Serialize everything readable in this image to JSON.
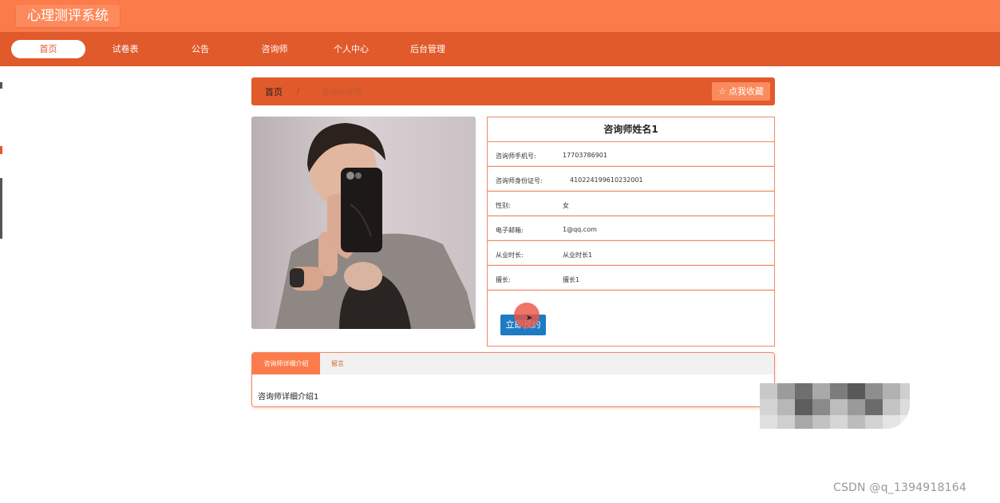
{
  "app": {
    "title": "心理测评系统"
  },
  "nav": {
    "items": [
      {
        "label": "首页"
      },
      {
        "label": "试卷表"
      },
      {
        "label": "公告"
      },
      {
        "label": "咨询师"
      },
      {
        "label": "个人中心"
      },
      {
        "label": "后台管理"
      }
    ],
    "active_index": 0
  },
  "breadcrumb": {
    "home": "首页",
    "separator": "/",
    "current": "咨询师详情",
    "favorite_label": "点我收藏"
  },
  "counselor": {
    "name": "咨询师姓名1",
    "fields": [
      {
        "label": "咨询师手机号:",
        "value": "17703786901"
      },
      {
        "label": "咨询师身份证号:",
        "value": "410224199610232001"
      },
      {
        "label": "性别:",
        "value": "女"
      },
      {
        "label": "电子邮箱:",
        "value": "1@qq.com"
      },
      {
        "label": "从业时长:",
        "value": "从业时长1"
      },
      {
        "label": "擅长:",
        "value": "擅长1"
      }
    ],
    "book_label": "立即预约"
  },
  "tabs": {
    "items": [
      {
        "label": "咨询师详细介绍"
      },
      {
        "label": "留言"
      }
    ],
    "content": "咨询师详细介绍1"
  },
  "watermark": "CSDN @q_1394918164",
  "colors": {
    "primary": "#fb7b4a",
    "nav": "#e15a2c",
    "book_button": "#1e7bc3"
  }
}
